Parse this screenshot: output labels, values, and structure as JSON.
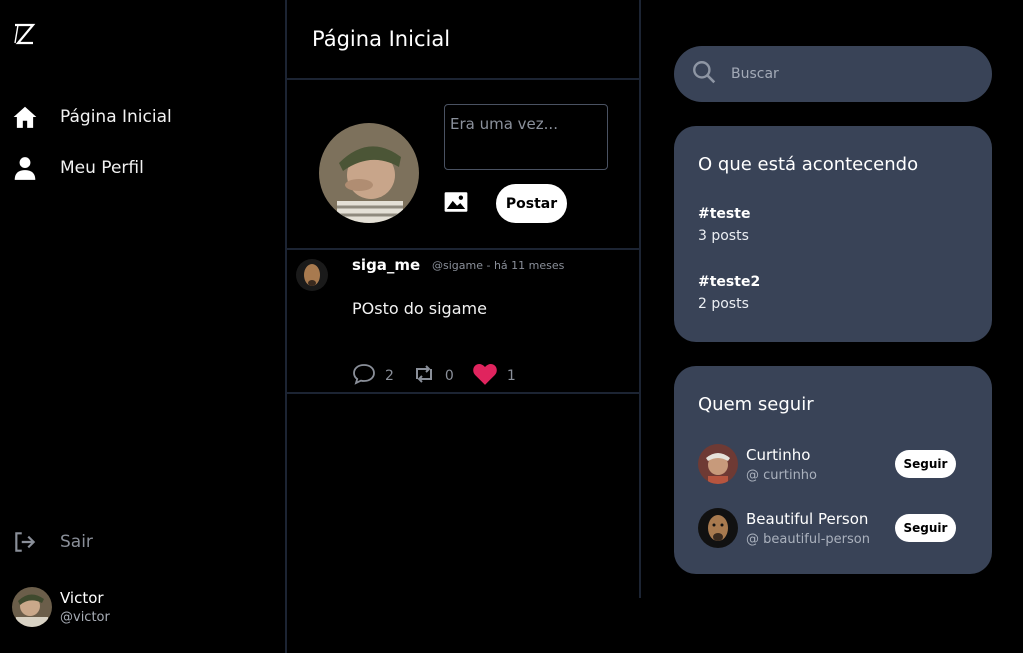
{
  "sidebar": {
    "nav": [
      {
        "label": "Página Inicial",
        "icon": "home-icon"
      },
      {
        "label": "Meu Perfil",
        "icon": "user-icon"
      }
    ],
    "logout_label": "Sair",
    "user": {
      "name": "Victor",
      "handle": "@victor"
    }
  },
  "main": {
    "title": "Página Inicial",
    "composer": {
      "placeholder": "Era uma vez...",
      "post_label": "Postar"
    },
    "posts": [
      {
        "author": "siga_me",
        "meta": "@sigame - há 11 meses",
        "body": "POsto do sigame",
        "comments": "2",
        "reposts": "0",
        "likes": "1"
      }
    ]
  },
  "right": {
    "search_placeholder": "Buscar",
    "trends": {
      "title": "O que está acontecendo",
      "items": [
        {
          "tag": "#teste",
          "count": "3 posts"
        },
        {
          "tag": "#teste2",
          "count": "2 posts"
        }
      ]
    },
    "follow": {
      "title": "Quem seguir",
      "button_label": "Seguir",
      "items": [
        {
          "name": "Curtinho",
          "handle": "@ curtinho"
        },
        {
          "name": "Beautiful Person",
          "handle": "@ beautiful-person"
        }
      ]
    }
  },
  "colors": {
    "background": "#000000",
    "panel": "#394357",
    "border": "#1c2433",
    "like": "#e0245e"
  }
}
